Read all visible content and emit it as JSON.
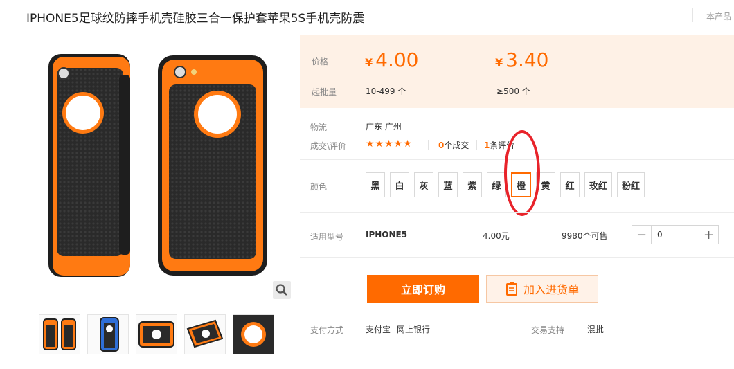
{
  "product": {
    "title": "IPHONE5足球纹防摔手机壳硅胶三合一保护套苹果5S手机壳防震",
    "notice": "本产品"
  },
  "pricing": {
    "price_label": "价格",
    "moq_label": "起批量",
    "currency": "¥",
    "tiers": [
      {
        "price": "4.00",
        "range": "10-499 个"
      },
      {
        "price": "3.40",
        "range": "≥500 个"
      }
    ]
  },
  "logistics": {
    "label": "物流",
    "value": "广东 广州"
  },
  "rating": {
    "label": "成交\\评价",
    "stars": "★★★★★",
    "deals_count": "0",
    "deals_text": "个成交",
    "reviews_count": "1",
    "reviews_text": "条评价"
  },
  "colors": {
    "label": "颜色",
    "options": [
      "黑",
      "白",
      "灰",
      "蓝",
      "紫",
      "绿",
      "橙",
      "黄",
      "红",
      "玫红",
      "粉红"
    ],
    "selected": "橙"
  },
  "model": {
    "label": "适用型号",
    "name": "IPHONE5",
    "price": "4.00元",
    "stock": "9980个可售",
    "quantity": "0"
  },
  "actions": {
    "buy": "立即订购",
    "cart": "加入进货单"
  },
  "payment": {
    "label": "支付方式",
    "method1": "支付宝",
    "method2": "网上银行",
    "trade_label": "交易支持",
    "trade_value": "混批"
  },
  "accent": "#ff6a00",
  "annotation_color": "#e8232a",
  "icons": [
    "zoom-icon",
    "clipboard-icon",
    "minus-icon",
    "plus-icon",
    "star-icon"
  ]
}
